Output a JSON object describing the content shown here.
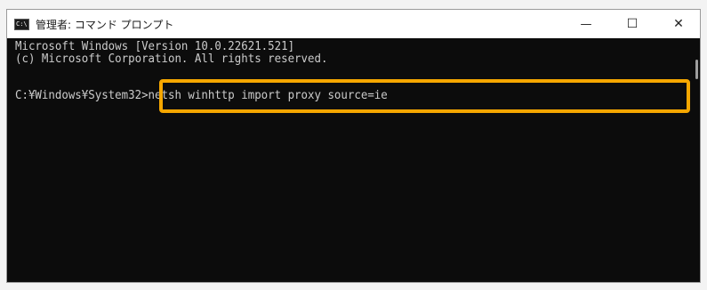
{
  "window": {
    "title": "管理者: コマンド プロンプト",
    "icon": "cmd-icon",
    "icon_glyph": "C:\\",
    "minimize_label": "—",
    "maximize_label": "☐",
    "close_label": "✕"
  },
  "console": {
    "lines": [
      "Microsoft Windows [Version 10.0.22621.521]",
      "(c) Microsoft Corporation. All rights reserved."
    ],
    "prompt": "C:¥Windows¥System32>",
    "command": "netsh winhttp import proxy source=ie",
    "text_color": "#cccccc",
    "background": "#0c0c0c"
  },
  "annotation": {
    "highlight_color": "#f6a700"
  }
}
